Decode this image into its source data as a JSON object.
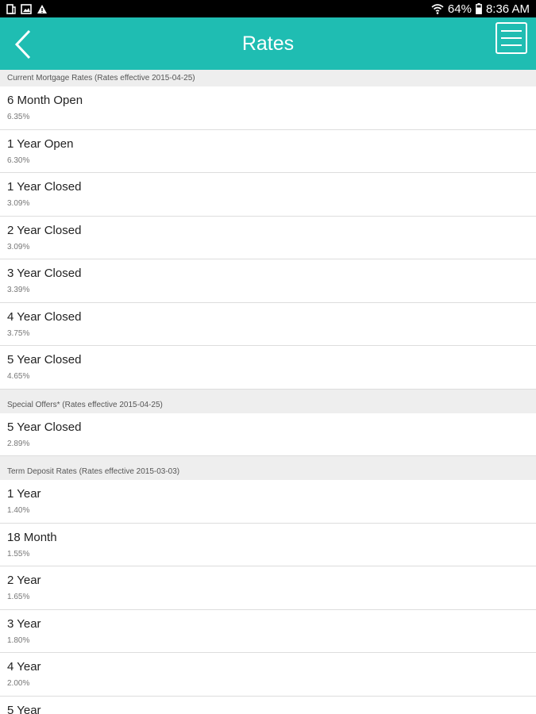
{
  "status_bar": {
    "battery": "64%",
    "time": "8:36 AM",
    "icons": [
      "notification-icon",
      "image-icon",
      "warning-icon",
      "wifi-icon",
      "battery-icon"
    ]
  },
  "app_bar": {
    "title": "Rates",
    "back_icon": "chevron-left-icon",
    "menu_icon": "hamburger-menu-icon",
    "color": "#1fbdb2"
  },
  "sections": [
    {
      "header": "Current Mortgage Rates (Rates effective 2015-04-25)",
      "items": [
        {
          "title": "6 Month Open",
          "rate": "6.35%"
        },
        {
          "title": "1 Year Open",
          "rate": "6.30%"
        },
        {
          "title": "1 Year Closed",
          "rate": "3.09%"
        },
        {
          "title": "2 Year Closed",
          "rate": "3.09%"
        },
        {
          "title": "3 Year Closed",
          "rate": "3.39%"
        },
        {
          "title": "4 Year Closed",
          "rate": "3.75%"
        },
        {
          "title": "5 Year Closed",
          "rate": "4.65%"
        }
      ]
    },
    {
      "header": "Special Offers* (Rates effective 2015-04-25)",
      "items": [
        {
          "title": "5 Year Closed",
          "rate": "2.89%"
        }
      ]
    },
    {
      "header": "Term Deposit Rates (Rates effective 2015-03-03)",
      "items": [
        {
          "title": "1 Year",
          "rate": "1.40%"
        },
        {
          "title": "18 Month",
          "rate": "1.55%"
        },
        {
          "title": "2 Year",
          "rate": "1.65%"
        },
        {
          "title": "3 Year",
          "rate": "1.80%"
        },
        {
          "title": "4 Year",
          "rate": "2.00%"
        },
        {
          "title": "5 Year",
          "rate": ""
        }
      ]
    }
  ]
}
